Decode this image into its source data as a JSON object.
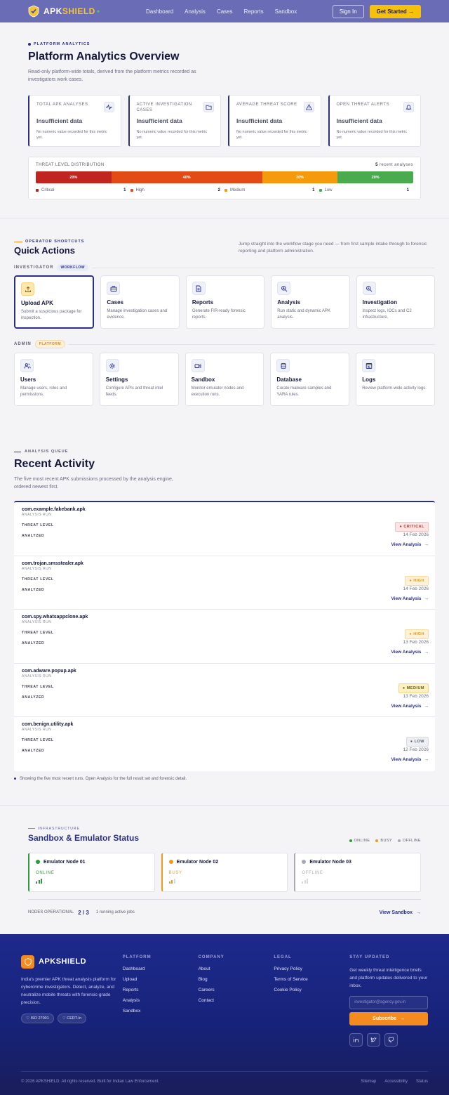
{
  "nav": {
    "brand_a": "APK",
    "brand_b": "SHIELD",
    "links": [
      "Dashboard",
      "Analysis",
      "Cases",
      "Reports",
      "Sandbox"
    ],
    "signin": "Sign In",
    "get_started": "Get Started",
    "arrow": "→"
  },
  "overview": {
    "eyebrow": "PLATFORM ANALYTICS",
    "title": "Platform Analytics Overview",
    "subtitle": "Read-only platform-wide totals, derived from the platform metrics recorded as investigators work cases.",
    "stats": [
      {
        "label": "TOTAL APK ANALYSES",
        "value": "Insufficient data",
        "note": "No numeric value recorded for this metric yet.",
        "icon": "activity-icon"
      },
      {
        "label": "ACTIVE INVESTIGATION CASES",
        "value": "Insufficient data",
        "note": "No numeric value recorded for this metric yet.",
        "icon": "folder-icon"
      },
      {
        "label": "AVERAGE THREAT SCORE",
        "value": "Insufficient data",
        "note": "No numeric value recorded for this metric yet.",
        "icon": "warning-icon"
      },
      {
        "label": "OPEN THREAT ALERTS",
        "value": "Insufficient data",
        "note": "No numeric value recorded for this metric yet.",
        "icon": "bell-icon"
      }
    ],
    "distribution": {
      "title": "THREAT LEVEL DISTRIBUTION",
      "count": "5",
      "count_label": "recent analyses",
      "segments": [
        {
          "name": "Critical",
          "pct": 20,
          "label": "20%",
          "count": "1",
          "color": "#c0251f"
        },
        {
          "name": "High",
          "pct": 40,
          "label": "40%",
          "count": "2",
          "color": "#e24b15"
        },
        {
          "name": "Medium",
          "pct": 20,
          "label": "20%",
          "count": "1",
          "color": "#f59a0c"
        },
        {
          "name": "Low",
          "pct": 20,
          "label": "20%",
          "count": "1",
          "color": "#4aaa4e"
        }
      ]
    }
  },
  "quick": {
    "eyebrow": "OPERATOR SHORTCUTS",
    "title": "Quick Actions",
    "subtitle": "Jump straight into the workflow stage you need — from first sample intake through to forensic reporting and platform administration.",
    "groups": [
      {
        "label": "INVESTIGATOR",
        "tag": "WORKFLOW",
        "items": [
          {
            "title": "Upload APK",
            "desc": "Submit a suspicious package for inspection.",
            "icon": "upload-icon"
          },
          {
            "title": "Cases",
            "desc": "Manage investigation cases and evidence.",
            "icon": "briefcase-icon"
          },
          {
            "title": "Reports",
            "desc": "Generate FIR-ready forensic reports.",
            "icon": "document-icon"
          },
          {
            "title": "Analysis",
            "desc": "Run static and dynamic APK analysis.",
            "icon": "zoom-icon"
          },
          {
            "title": "Investigation",
            "desc": "Inspect logs, IOCs and C2 infrastructure.",
            "icon": "search-icon"
          }
        ]
      },
      {
        "label": "ADMIN",
        "tag": "PLATFORM",
        "items": [
          {
            "title": "Users",
            "desc": "Manage users, roles and permissions.",
            "icon": "users-icon"
          },
          {
            "title": "Settings",
            "desc": "Configure APIs and threat intel feeds.",
            "icon": "gear-icon"
          },
          {
            "title": "Sandbox",
            "desc": "Monitor emulator nodes and execution runs.",
            "icon": "video-icon"
          },
          {
            "title": "Database",
            "desc": "Curate malware samples and YARA rules.",
            "icon": "database-icon"
          },
          {
            "title": "Logs",
            "desc": "Review platform-wide activity logs.",
            "icon": "log-icon"
          }
        ]
      }
    ]
  },
  "recent": {
    "eyebrow": "ANALYSIS QUEUE",
    "title": "Recent Activity",
    "subtitle": "The five most recent APK submissions processed by the analysis engine, ordered newest first.",
    "k_threat": "THREAT LEVEL",
    "k_analyzed": "ANALYZED",
    "kind": "ANALYSIS RUN",
    "view": "View Analysis",
    "rows": [
      {
        "pkg": "com.example.fakebank.apk",
        "level": "CRITICAL",
        "cls": "crit",
        "date": "14 Feb 2026"
      },
      {
        "pkg": "com.trojan.smsstealer.apk",
        "level": "HIGH",
        "cls": "high",
        "date": "14 Feb 2026"
      },
      {
        "pkg": "com.spy.whatsappclone.apk",
        "level": "HIGH",
        "cls": "high",
        "date": "13 Feb 2026"
      },
      {
        "pkg": "com.adware.popup.apk",
        "level": "MEDIUM",
        "cls": "med",
        "date": "13 Feb 2026"
      },
      {
        "pkg": "com.benign.utility.apk",
        "level": "LOW",
        "cls": "low",
        "date": "12 Feb 2026"
      }
    ],
    "footnote": "Showing the five most recent runs. Open Analysis for the full result set and forensic detail."
  },
  "sandbox": {
    "eyebrow": "INFRASTRUCTURE",
    "title": "Sandbox & Emulator Status",
    "legend": [
      {
        "label": "ONLINE",
        "color": "#2e9a3e"
      },
      {
        "label": "BUSY",
        "color": "#f09a1a"
      },
      {
        "label": "OFFLINE",
        "color": "#a8aab4"
      }
    ],
    "nodes": [
      {
        "name": "Emulator Node 01",
        "status": "ONLINE",
        "color": "#2e9a3e",
        "bars": 3
      },
      {
        "name": "Emulator Node 02",
        "status": "BUSY",
        "color": "#f09a1a",
        "bars": 2
      },
      {
        "name": "Emulator Node 03",
        "status": "OFFLINE",
        "color": "#a8aab4",
        "bars": 0
      }
    ],
    "ops_label": "NODES OPERATIONAL",
    "ops_value": "2 / 3",
    "jobs": "1 running active jobs",
    "view": "View Sandbox"
  },
  "footer": {
    "brand": "APKSHIELD",
    "about": "India's premier APK threat analysis platform for cybercrime investigators. Detect, analyze, and neutralize mobile threats with forensic-grade precision.",
    "pills": [
      "ISO 27001",
      "CERT-In"
    ],
    "cols": [
      {
        "title": "PLATFORM",
        "links": [
          "Dashboard",
          "Upload",
          "Reports",
          "Analysis",
          "Sandbox"
        ]
      },
      {
        "title": "COMPANY",
        "links": [
          "About",
          "Blog",
          "Careers",
          "Contact"
        ]
      },
      {
        "title": "LEGAL",
        "links": [
          "Privacy Policy",
          "Terms of Service",
          "Cookie Policy"
        ]
      }
    ],
    "newsletter_title": "STAY UPDATED",
    "newsletter_text": "Get weekly threat intelligence briefs and platform updates delivered to your inbox.",
    "email_placeholder": "investigator@agency.gov.in",
    "subscribe": "Subscribe",
    "copyright": "© 2026 APKSHIELD. All rights reserved. Built for Indian Law Enforcement.",
    "bottom_links": [
      "Sitemap",
      "Accessibility",
      "Status"
    ]
  }
}
